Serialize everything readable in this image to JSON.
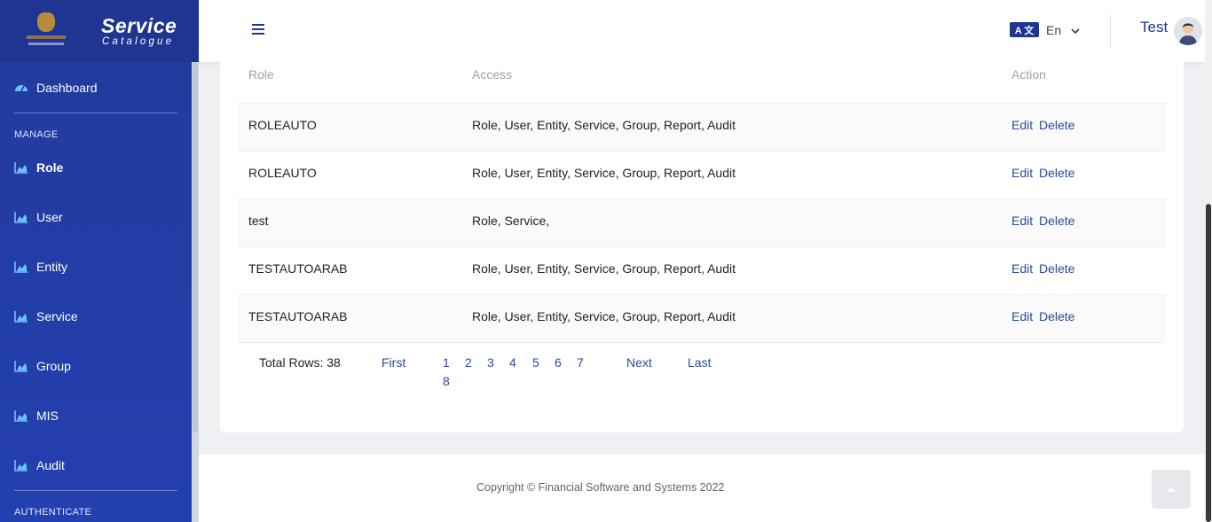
{
  "brand": {
    "title": "Service",
    "subtitle": "Catalogue"
  },
  "sidebar": {
    "dashboard": "Dashboard",
    "section_manage": "MANAGE",
    "items": [
      {
        "label": "Role",
        "active": true
      },
      {
        "label": "User"
      },
      {
        "label": "Entity"
      },
      {
        "label": "Service"
      },
      {
        "label": "Group"
      },
      {
        "label": "MIS"
      },
      {
        "label": "Audit"
      }
    ],
    "section_authenticate": "AUTHENTICATE"
  },
  "header": {
    "language_badge": "A 文",
    "language": "En",
    "user": "Test"
  },
  "table": {
    "columns": {
      "role": "Role",
      "access": "Access",
      "action": "Action"
    },
    "rows": [
      {
        "role": "ROLEAUTO",
        "access": "Role, User, Entity, Service, Group, Report, Audit",
        "edit": "Edit",
        "delete": "Delete"
      },
      {
        "role": "ROLEAUTO",
        "access": "Role, User, Entity, Service, Group, Report, Audit",
        "edit": "Edit",
        "delete": "Delete"
      },
      {
        "role": "test",
        "access": "Role, Service,",
        "edit": "Edit",
        "delete": "Delete"
      },
      {
        "role": "TESTAUTOARAB",
        "access": "Role, User, Entity, Service, Group, Report, Audit",
        "edit": "Edit",
        "delete": "Delete"
      },
      {
        "role": "TESTAUTOARAB",
        "access": "Role, User, Entity, Service, Group, Report, Audit",
        "edit": "Edit",
        "delete": "Delete"
      }
    ]
  },
  "pagination": {
    "total": "Total Rows: 38",
    "first": "First",
    "pages": [
      "1",
      "2",
      "3",
      "4",
      "5",
      "6",
      "7",
      "8"
    ],
    "next": "Next",
    "last": "Last"
  },
  "footer": {
    "copyright": "Copyright © Financial Software and Systems 2022"
  },
  "colors": {
    "sidebar": "#213a9c",
    "accent": "#1e3591",
    "link": "#2c4a9b"
  }
}
